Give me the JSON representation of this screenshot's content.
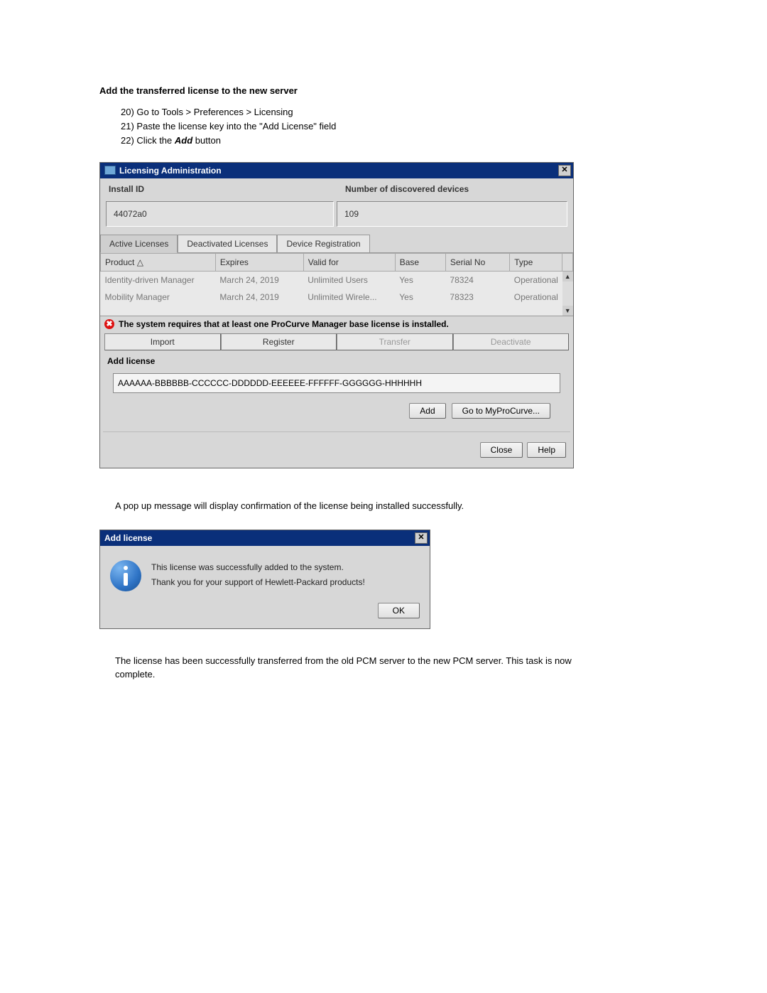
{
  "doc": {
    "section_title": "Add the transferred license to the new server",
    "steps": [
      {
        "num": "20)",
        "text": "Go to Tools > Preferences > Licensing"
      },
      {
        "num": "21)",
        "text": "Paste the license key into the \"Add License\" field"
      },
      {
        "num": "22)",
        "text_a": "Click the ",
        "bold": "Add",
        "text_b": " button"
      }
    ],
    "narrative1": "A pop up message will display confirmation of the license being installed successfully.",
    "narrative2": "The license has been successfully transferred from the old PCM server to the new PCM server. This task is now complete."
  },
  "licensing_window": {
    "title": "Licensing Administration",
    "close_x": "✕",
    "install_id_label": "Install ID",
    "devices_label": "Number of discovered devices",
    "install_id_value": "44072a0",
    "devices_value": "109",
    "tabs": {
      "active": "Active Licenses",
      "deactivated": "Deactivated Licenses",
      "device_reg": "Device Registration"
    },
    "columns": {
      "product": "Product △",
      "expires": "Expires",
      "valid_for": "Valid for",
      "base": "Base",
      "serial_no": "Serial No",
      "type": "Type"
    },
    "rows": [
      {
        "product": "Identity-driven Manager",
        "expires": "March 24, 2019",
        "valid_for": "Unlimited Users",
        "base": "Yes",
        "serial_no": "78324",
        "type": "Operational"
      },
      {
        "product": "Mobility Manager",
        "expires": "March 24, 2019",
        "valid_for": "Unlimited Wirele...",
        "base": "Yes",
        "serial_no": "78323",
        "type": "Operational"
      }
    ],
    "warning": "The system requires that at least one ProCurve Manager base license is installed.",
    "action_buttons": {
      "import": "Import",
      "register": "Register",
      "transfer": "Transfer",
      "deactivate": "Deactivate"
    },
    "add_license_label": "Add license",
    "license_input_value": "AAAAAA-BBBBBB-CCCCCC-DDDDDD-EEEEEE-FFFFFF-GGGGGG-HHHHHH",
    "add_btn": "Add",
    "myprocurve_btn": "Go to MyProCurve...",
    "close_btn": "Close",
    "help_btn": "Help",
    "arrow_up": "▲",
    "arrow_down": "▼"
  },
  "popup": {
    "title": "Add license",
    "close_x": "✕",
    "line1": "This license was successfully added to the system.",
    "line2": "Thank you for your support of Hewlett-Packard products!",
    "ok_btn": "OK"
  }
}
